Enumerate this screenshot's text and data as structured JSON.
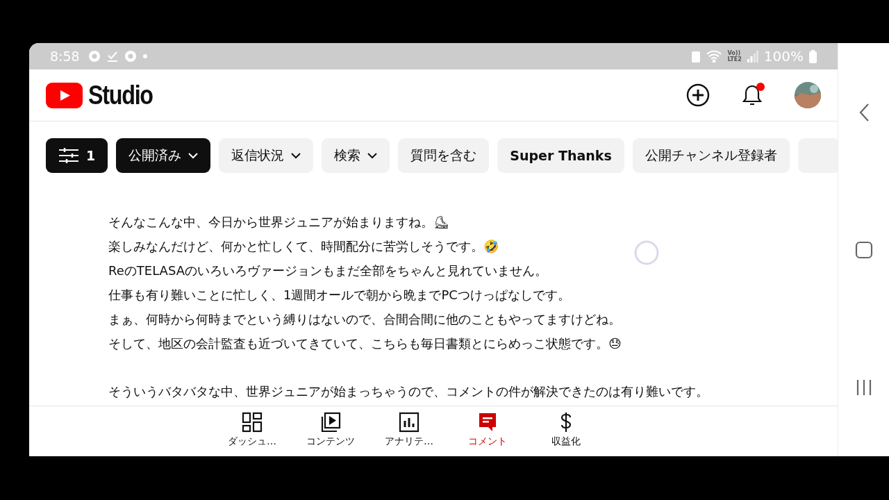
{
  "status_bar": {
    "time": "8:58",
    "volte": "Vo))",
    "network": "LTE2",
    "battery": "100%"
  },
  "header": {
    "logo_text": "Studio",
    "notification_dot": true
  },
  "filters": [
    {
      "label": "1",
      "kind": "filter",
      "selected": true
    },
    {
      "label": "公開済み",
      "kind": "chip",
      "selected": true,
      "dropdown": true
    },
    {
      "label": "返信状況",
      "kind": "chip",
      "selected": false,
      "dropdown": true
    },
    {
      "label": "検索",
      "kind": "chip",
      "selected": false,
      "dropdown": true
    },
    {
      "label": "質問を含む",
      "kind": "chip",
      "selected": false,
      "dropdown": false
    },
    {
      "label": "Super Thanks",
      "kind": "chip",
      "selected": false,
      "dropdown": false
    },
    {
      "label": "公開チャンネル登録者",
      "kind": "chip",
      "selected": false,
      "dropdown": false
    },
    {
      "kind": "cut",
      "selected": false
    }
  ],
  "comment_paragraphs": [
    [
      "そんなこんな中、今日から世界ジュニアが始まりますね。⛸",
      "楽しみなんだけど、何かと忙しくて、時間配分に苦労しそうです。🤣",
      "ReのTELASAのいろいろヴァージョンもまだ全部をちゃんと見れていません。",
      "仕事も有り難いことに忙しく、1週間オールで朝から晩までPCつけっぱなしです。",
      "まぁ、何時から何時までという縛りはないので、合間合間に他のこともやってますけどね。",
      "そして、地区の会計監査も近づいてきていて、こちらも毎日書類とにらめっこ状態です。😓"
    ],
    [
      "そういうバタバタな中、世界ジュニアが始まっちゃうので、コメントの件が解決できたのは有り難いです。"
    ]
  ],
  "bottom_nav": [
    {
      "label": "ダッシュ…",
      "kind": "dashboard",
      "selected": false
    },
    {
      "label": "コンテンツ",
      "kind": "content",
      "selected": false
    },
    {
      "label": "アナリテ…",
      "kind": "analytics",
      "selected": false
    },
    {
      "label": "コメント",
      "kind": "comments",
      "selected": true
    },
    {
      "label": "収益化",
      "kind": "earn",
      "selected": false
    }
  ]
}
